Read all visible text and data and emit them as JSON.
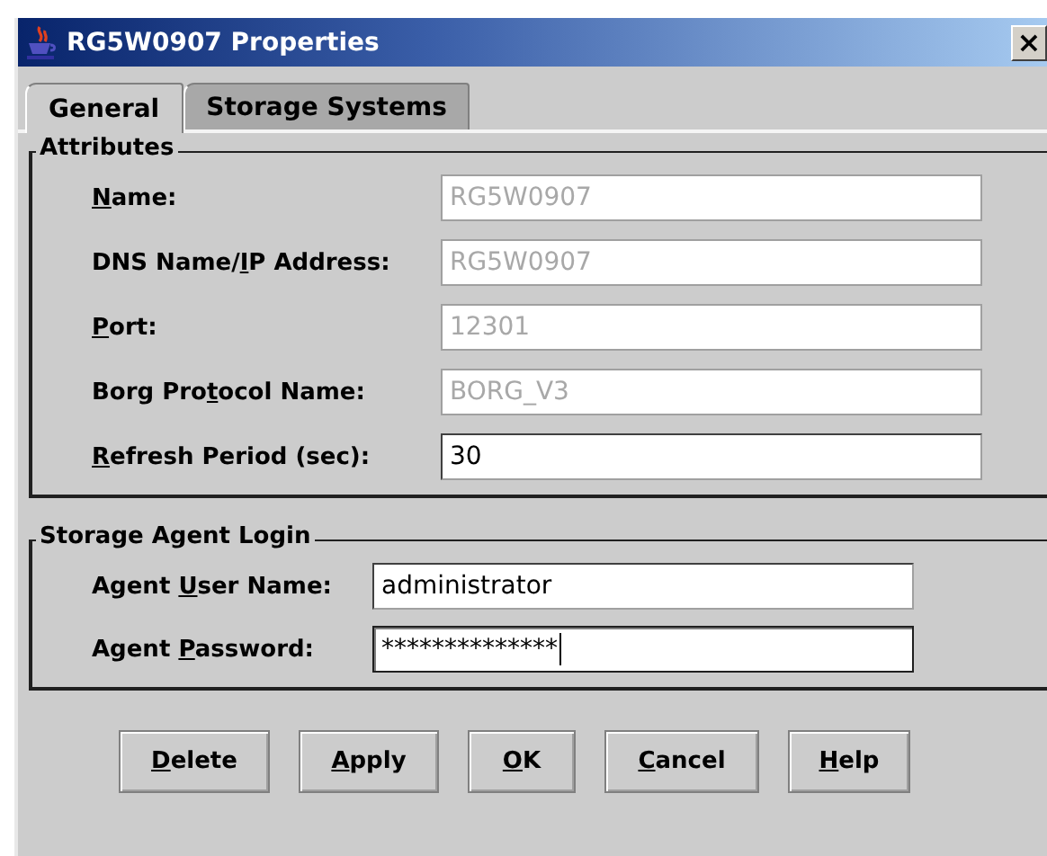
{
  "window": {
    "title": "RG5W0907 Properties",
    "close_symbol": "×"
  },
  "tabs": [
    {
      "label": "General",
      "selected": true
    },
    {
      "label": "Storage Systems",
      "selected": false
    }
  ],
  "groups": [
    {
      "title": "Attributes",
      "fields": [
        {
          "label": {
            "key": "N",
            "post": "ame:"
          },
          "value": "RG5W0907",
          "disabled": true,
          "focused": false
        },
        {
          "label": {
            "pre": "DNS Name/",
            "key": "I",
            "post": "P Address:"
          },
          "value": "RG5W0907",
          "disabled": true,
          "focused": false
        },
        {
          "label": {
            "key": "P",
            "post": "ort:"
          },
          "value": "12301",
          "disabled": true,
          "focused": false
        },
        {
          "label": {
            "pre": "Borg Pro",
            "key": "t",
            "post": "ocol Name:"
          },
          "value": "BORG_V3",
          "disabled": true,
          "focused": false
        },
        {
          "label": {
            "key": "R",
            "post": "efresh Period (sec):"
          },
          "value": "30",
          "disabled": false,
          "focused": false
        }
      ]
    },
    {
      "title": "Storage Agent Login",
      "fields": [
        {
          "label": {
            "pre": "Agent ",
            "key": "U",
            "post": "ser Name:"
          },
          "value": "administrator",
          "disabled": false,
          "focused": false
        },
        {
          "label": {
            "pre": "Agent ",
            "key": "P",
            "post": "assword:"
          },
          "value": "**************",
          "disabled": false,
          "focused": true
        }
      ]
    }
  ],
  "buttons": [
    {
      "label": {
        "key": "D",
        "post": "elete"
      }
    },
    {
      "label": {
        "key": "A",
        "post": "pply"
      }
    },
    {
      "label": {
        "key": "O",
        "post": "K"
      }
    },
    {
      "label": {
        "key": "C",
        "post": "ancel"
      }
    },
    {
      "label": {
        "key": "H",
        "post": "elp"
      }
    }
  ]
}
